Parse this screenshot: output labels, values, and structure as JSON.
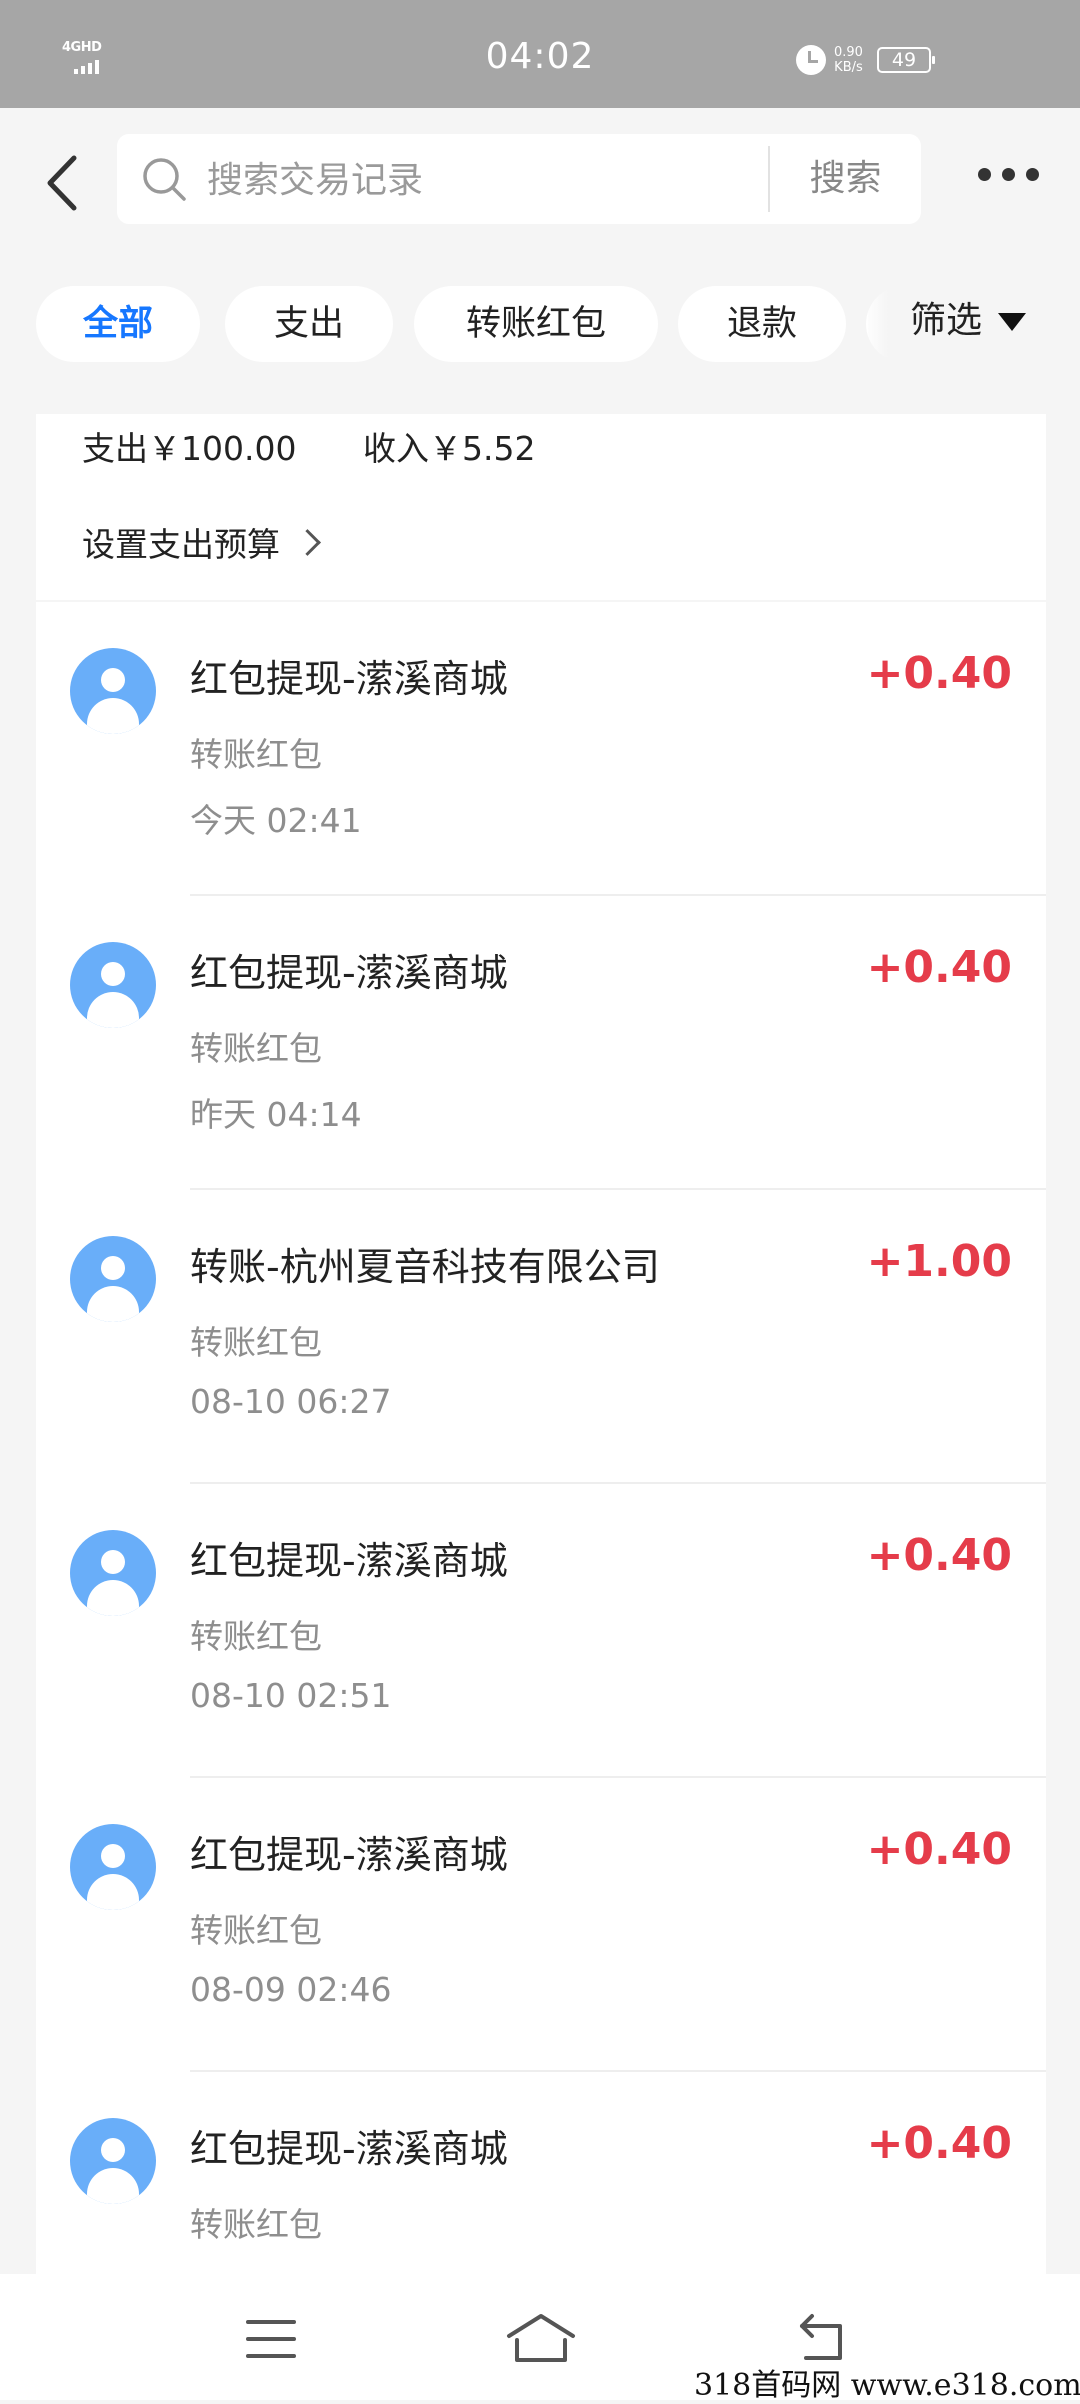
{
  "status_bar": {
    "network": "4GHD",
    "time": "04:02",
    "speed_value": "0.90",
    "speed_unit": "KB/s",
    "battery": "49"
  },
  "header": {
    "search_placeholder": "搜索交易记录",
    "search_button": "搜索"
  },
  "filters": {
    "chips": [
      "全部",
      "支出",
      "转账红包",
      "退款"
    ],
    "filter_label": "筛选"
  },
  "summary": {
    "expense": "支出￥100.00",
    "income": "收入￥5.52",
    "budget_link": "设置支出预算"
  },
  "transactions": [
    {
      "title": "红包提现-潆溪商城",
      "category": "转账红包",
      "time": "今天 02:41",
      "amount": "+0.40"
    },
    {
      "title": "红包提现-潆溪商城",
      "category": "转账红包",
      "time": "昨天 04:14",
      "amount": "+0.40"
    },
    {
      "title": "转账-杭州夏音科技有限公司",
      "category": "转账红包",
      "time": "08-10 06:27",
      "amount": "+1.00"
    },
    {
      "title": "红包提现-潆溪商城",
      "category": "转账红包",
      "time": "08-10 02:51",
      "amount": "+0.40"
    },
    {
      "title": "红包提现-潆溪商城",
      "category": "转账红包",
      "time": "08-09 02:46",
      "amount": "+0.40"
    },
    {
      "title": "红包提现-潆溪商城",
      "category": "转账红包",
      "time": "",
      "amount": "+0.40"
    }
  ],
  "watermark": "318首码网  www.e318.com",
  "colors": {
    "accent": "#1677ff",
    "income": "#e53c4a",
    "avatar": "#69aef9"
  }
}
